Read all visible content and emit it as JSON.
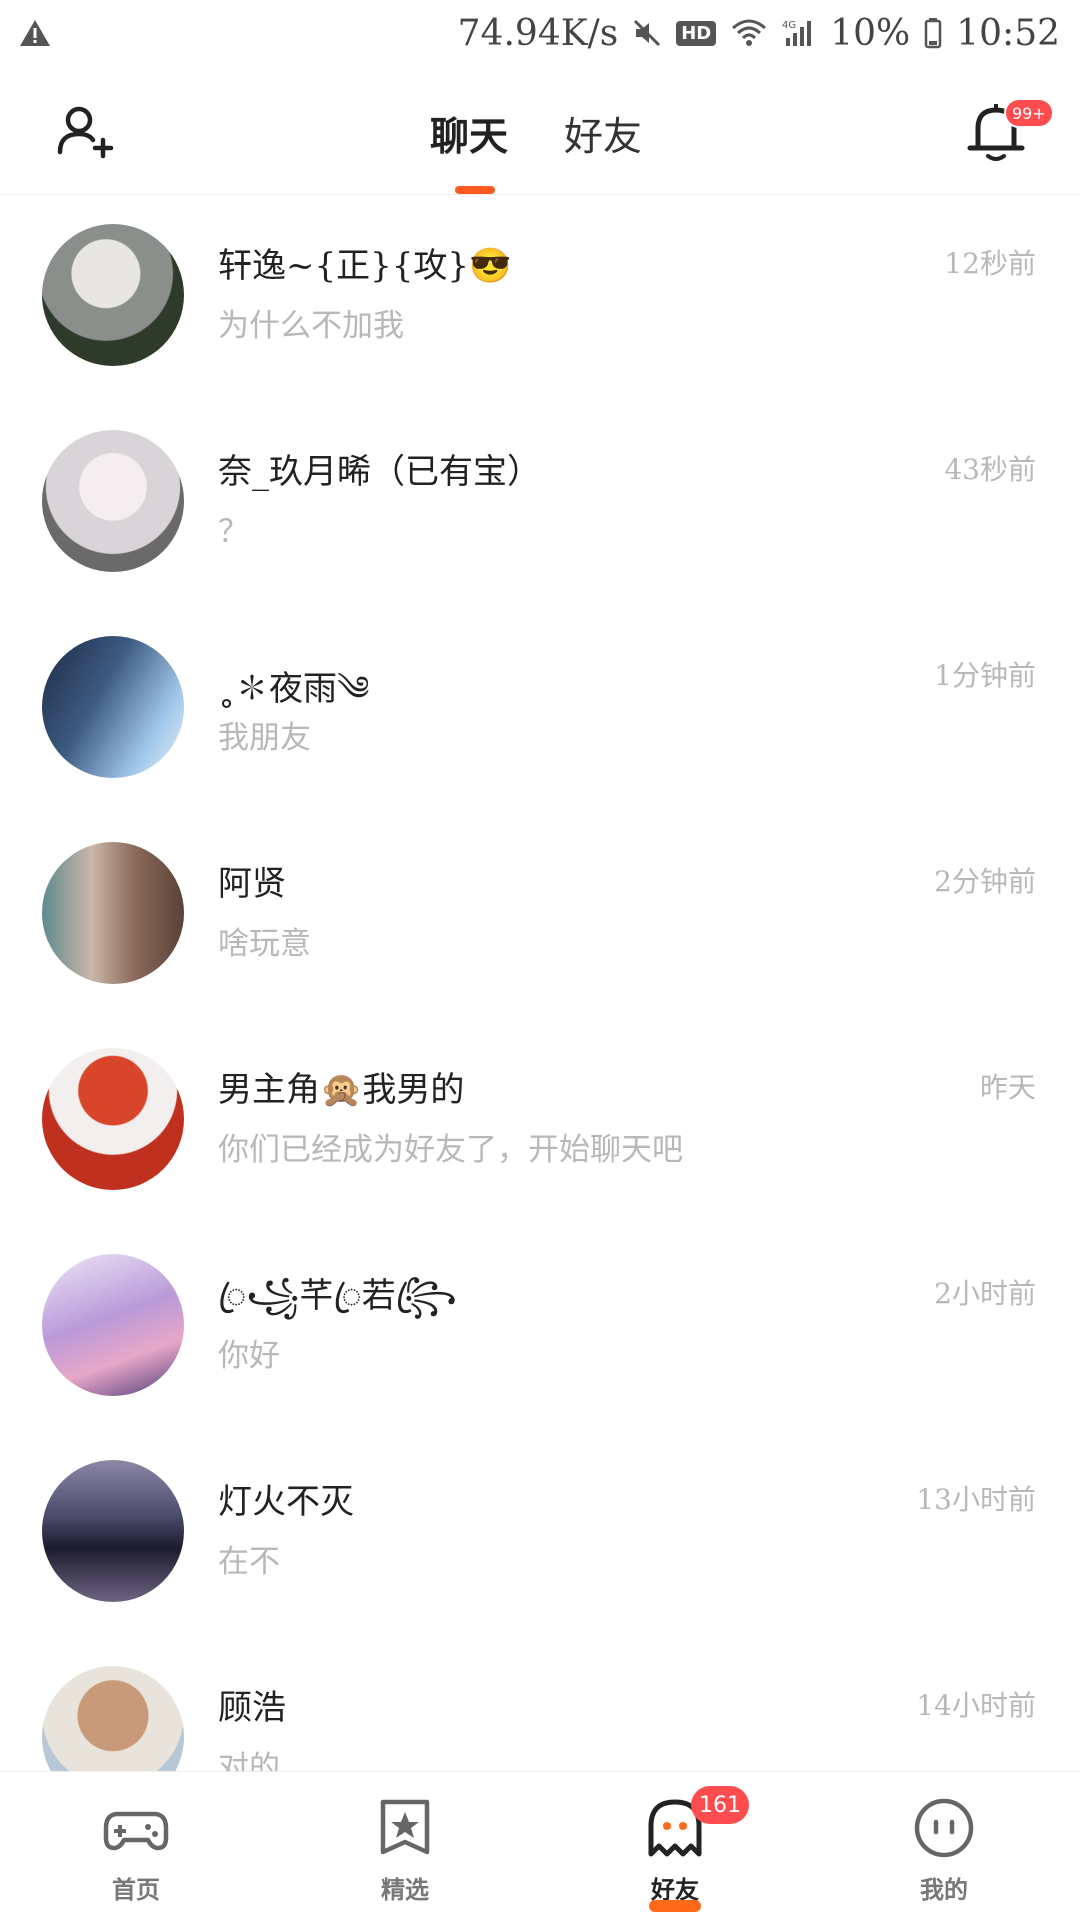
{
  "status_bar": {
    "net_speed": "74.94K/s",
    "hd_label": "HD",
    "network_label": "4G",
    "battery": "10%",
    "time": "10:52",
    "icons": [
      "warning-icon",
      "mute-icon",
      "hd-icon",
      "wifi-icon",
      "signal-icon",
      "battery-icon"
    ]
  },
  "header": {
    "tabs": [
      {
        "label": "聊天",
        "active": true
      },
      {
        "label": "好友",
        "active": false
      }
    ],
    "notification_badge": "99+",
    "accent_color": "#ff5a1f"
  },
  "chats": [
    {
      "name": "轩逸~{正}{攻}😎",
      "message": "为什么不加我",
      "time": "12秒前",
      "avatar_color": "#8a8f8c"
    },
    {
      "name": "奈_玖月晞（已有宝）",
      "message": "？",
      "time": "43秒前",
      "avatar_color": "#d9d4d8"
    },
    {
      "name": "˳✽夜雨༄",
      "message": "我朋友",
      "time": "1分钟前",
      "avatar_color": "#3c5a80"
    },
    {
      "name": "阿贤",
      "message": "啥玩意",
      "time": "2分钟前",
      "avatar_color": "#8b6a5a"
    },
    {
      "name": "男主角🙊我男的",
      "message": "你们已经成为好友了，开始聊天吧",
      "time": "昨天",
      "avatar_color": "#d9452a"
    },
    {
      "name": "ꦿ꧁芊ꦿ若꧂ꦿ",
      "message": "你好",
      "time": "2小时前",
      "avatar_color": "#b99ad9"
    },
    {
      "name": "灯火不灭",
      "message": "在不",
      "time": "13小时前",
      "avatar_color": "#4a4a6a"
    },
    {
      "name": "顾浩",
      "message": "对的",
      "time": "14小时前",
      "avatar_color": "#c89a7a"
    }
  ],
  "bottom_nav": {
    "items": [
      {
        "label": "首页",
        "icon": "gamepad-icon"
      },
      {
        "label": "精选",
        "icon": "star-icon"
      },
      {
        "label": "好友",
        "icon": "ghost-icon",
        "badge": "161",
        "active": true
      },
      {
        "label": "我的",
        "icon": "face-icon"
      }
    ]
  }
}
